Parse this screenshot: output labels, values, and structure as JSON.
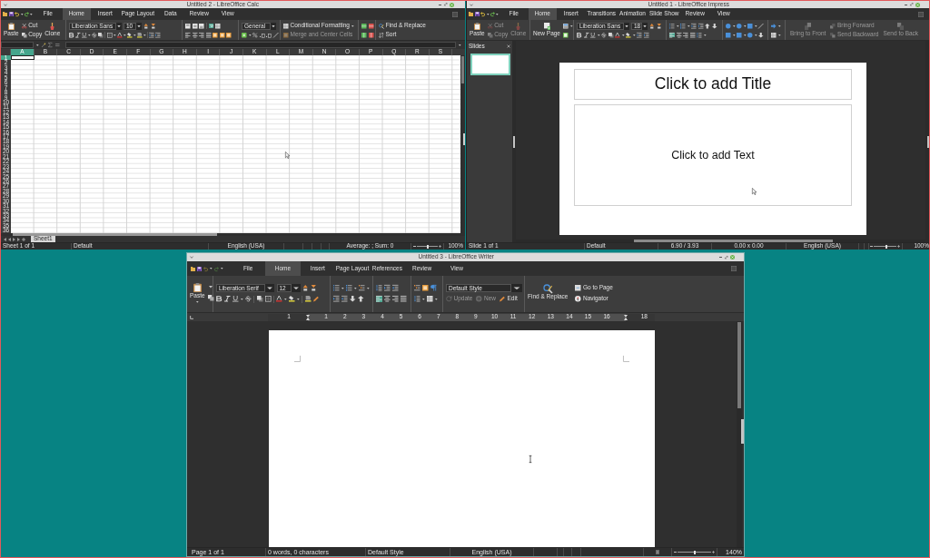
{
  "calc": {
    "title": "Untitled 2 - LibreOffice Calc",
    "tabs": [
      {
        "label": "File",
        "selected": false
      },
      {
        "label": "Home",
        "selected": true
      },
      {
        "label": "Insert",
        "selected": false
      },
      {
        "label": "Page Layout",
        "selected": false
      },
      {
        "label": "Data",
        "selected": false
      },
      {
        "label": "Review",
        "selected": false
      },
      {
        "label": "View",
        "selected": false
      }
    ],
    "clipboard": [
      {
        "label": "Paste",
        "disabled": false
      },
      {
        "label": "Cut",
        "disabled": false
      },
      {
        "label": "Copy",
        "disabled": false
      },
      {
        "label": "Clone",
        "disabled": false
      }
    ],
    "font_name": "Liberation Sans",
    "font_size": "10",
    "wrap_text_on": true,
    "number_format": "General",
    "commands": [
      {
        "label": "Conditional Formatting",
        "disabled": false
      },
      {
        "label": "Merge and Center Cells",
        "disabled": true
      }
    ],
    "find": [
      "Find & Replace",
      "Sort"
    ],
    "columns": [
      {
        "label": "A",
        "selected": true
      },
      {
        "label": "B",
        "selected": false
      },
      {
        "label": "C",
        "selected": false
      },
      {
        "label": "D",
        "selected": false
      },
      {
        "label": "E",
        "selected": false
      },
      {
        "label": "F",
        "selected": false
      },
      {
        "label": "G",
        "selected": false
      },
      {
        "label": "H",
        "selected": false
      },
      {
        "label": "I",
        "selected": false
      },
      {
        "label": "J",
        "selected": false
      },
      {
        "label": "K",
        "selected": false
      },
      {
        "label": "L",
        "selected": false
      },
      {
        "label": "M",
        "selected": false
      },
      {
        "label": "N",
        "selected": false
      },
      {
        "label": "O",
        "selected": false
      },
      {
        "label": "P",
        "selected": false
      },
      {
        "label": "Q",
        "selected": false
      },
      {
        "label": "R",
        "selected": false
      },
      {
        "label": "S",
        "selected": false
      }
    ],
    "rows": [
      {
        "label": "1",
        "selected": true
      },
      {
        "label": "2",
        "selected": false
      },
      {
        "label": "3",
        "selected": false
      },
      {
        "label": "4",
        "selected": false
      },
      {
        "label": "5",
        "selected": false
      },
      {
        "label": "6",
        "selected": false
      },
      {
        "label": "7",
        "selected": false
      },
      {
        "label": "8",
        "selected": false
      },
      {
        "label": "9",
        "selected": false
      },
      {
        "label": "10",
        "selected": false
      },
      {
        "label": "11",
        "selected": false
      },
      {
        "label": "12",
        "selected": false
      },
      {
        "label": "13",
        "selected": false
      },
      {
        "label": "14",
        "selected": false
      },
      {
        "label": "15",
        "selected": false
      },
      {
        "label": "16",
        "selected": false
      },
      {
        "label": "17",
        "selected": false
      },
      {
        "label": "18",
        "selected": false
      },
      {
        "label": "19",
        "selected": false
      },
      {
        "label": "20",
        "selected": false
      },
      {
        "label": "21",
        "selected": false
      },
      {
        "label": "22",
        "selected": false
      },
      {
        "label": "23",
        "selected": false
      },
      {
        "label": "24",
        "selected": false
      },
      {
        "label": "25",
        "selected": false
      },
      {
        "label": "26",
        "selected": false
      },
      {
        "label": "27",
        "selected": false
      },
      {
        "label": "28",
        "selected": false
      },
      {
        "label": "29",
        "selected": false
      },
      {
        "label": "30",
        "selected": false
      },
      {
        "label": "31",
        "selected": false
      },
      {
        "label": "32",
        "selected": false
      },
      {
        "label": "33",
        "selected": false
      },
      {
        "label": "34",
        "selected": false
      },
      {
        "label": "35",
        "selected": false
      },
      {
        "label": "36",
        "selected": false
      }
    ],
    "sheet_tabs": [
      {
        "label": "Sheet1",
        "selected": true
      }
    ],
    "status_bar": [
      "Sheet 1 of 1",
      "Default",
      "English (USA)",
      "Average: ; Sum: 0",
      "100%"
    ],
    "zoom": {
      "level": 0.5
    }
  },
  "impress": {
    "title": "Untitled 1 - LibreOffice Impress",
    "tabs": [
      {
        "label": "File",
        "selected": false
      },
      {
        "label": "Home",
        "selected": true
      },
      {
        "label": "Insert",
        "selected": false
      },
      {
        "label": "Transitions",
        "selected": false
      },
      {
        "label": "Animation",
        "selected": false
      },
      {
        "label": "Slide Show",
        "selected": false
      },
      {
        "label": "Review",
        "selected": false
      },
      {
        "label": "View",
        "selected": false
      }
    ],
    "clipboard": [
      {
        "label": "Paste",
        "disabled": false
      },
      {
        "label": "Cut",
        "disabled": true
      },
      {
        "label": "Copy",
        "disabled": true
      },
      {
        "label": "Clone",
        "disabled": true
      }
    ],
    "new_page": "New Page",
    "font_name": "Liberation Sans",
    "font_size": "18",
    "align_left_on": true,
    "arrange": [
      {
        "label": "Bring to Front",
        "disabled": true
      },
      {
        "label": "Bring Forward",
        "disabled": true
      },
      {
        "label": "Send Backward",
        "disabled": true
      },
      {
        "label": "Send to Back",
        "disabled": true
      }
    ],
    "slides_panel": {
      "title": "Slides",
      "slides": [
        {
          "selected": true
        }
      ]
    },
    "slide": {
      "title_placeholder": "Click to add Title",
      "text_placeholder": "Click to add Text"
    },
    "status_bar": [
      "Slide 1 of 1",
      "Default",
      "6.90 / 3.93",
      "0.00 x 0.00",
      "English (USA)",
      "100%"
    ],
    "zoom": {
      "level": 0.55
    }
  },
  "writer": {
    "title": "Untitled 3 - LibreOffice Writer",
    "tabs": [
      {
        "label": "File",
        "selected": false
      },
      {
        "label": "Home",
        "selected": true
      },
      {
        "label": "Insert",
        "selected": false
      },
      {
        "label": "Page Layout",
        "selected": false
      },
      {
        "label": "References",
        "selected": false
      },
      {
        "label": "Review",
        "selected": false
      },
      {
        "label": "View",
        "selected": false
      }
    ],
    "paste": "Paste",
    "font_name": "Liberation Serif",
    "font_size": "12",
    "align_left_on": true,
    "paragraph_style": "Default Style",
    "style_actions": [
      {
        "label": "Update",
        "disabled": true
      },
      {
        "label": "New",
        "disabled": true
      },
      {
        "label": "Edit",
        "disabled": false
      }
    ],
    "find_replace": "Find & Replace",
    "navigation": [
      "Go to Page",
      "Navigator"
    ],
    "ruler": [
      "1",
      "1",
      "2",
      "3",
      "4",
      "5",
      "6",
      "7",
      "8",
      "9",
      "10",
      "11",
      "12",
      "13",
      "14",
      "15",
      "16",
      "18"
    ],
    "status_bar": [
      "Page 1 of 1",
      "0 words, 0 characters",
      "Default Style",
      "English (USA)",
      "140%"
    ],
    "zoom": {
      "level": 0.5
    }
  }
}
